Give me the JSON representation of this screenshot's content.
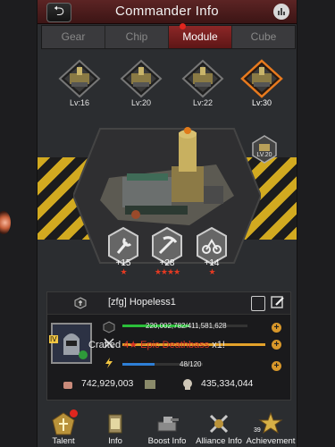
{
  "header": {
    "title": "Commander Info"
  },
  "tabs": [
    {
      "label": "Gear",
      "active": false
    },
    {
      "label": "Chip",
      "active": false
    },
    {
      "label": "Module",
      "active": true
    },
    {
      "label": "Cube",
      "active": false
    }
  ],
  "modules": [
    {
      "level": "Lv:16"
    },
    {
      "level": "Lv:20"
    },
    {
      "level": "Lv:22"
    },
    {
      "level": "Lv:30",
      "selected": true
    }
  ],
  "small_module": {
    "level": "LV.20"
  },
  "chips": [
    {
      "bonus": "+15",
      "stars": "★"
    },
    {
      "bonus": "+28",
      "stars": "★★★★"
    },
    {
      "bonus": "+14",
      "stars": "★"
    }
  ],
  "player": {
    "name": "[zfg]  Hopeless1",
    "avatar_badge": "IV"
  },
  "stats": {
    "xp": "220,002,782/411,581,628",
    "stamina": "48/120",
    "power": "742,929,003",
    "kills": "435,334,044"
  },
  "announcement": {
    "prefix": "Crafted ",
    "highlight": "4★ Epic Deathbass",
    "suffix": " x1!"
  },
  "nav": [
    {
      "label": "Talent",
      "alert": true
    },
    {
      "label": "Info"
    },
    {
      "label": "Boost Info"
    },
    {
      "label": "Alliance Info"
    },
    {
      "label": "Achievement",
      "count": "39"
    }
  ],
  "colors": {
    "accent_red": "#8c2727",
    "xp_bar": "#2bbf3a",
    "gold_bar": "#e3a22a",
    "stamina_bar": "#2e7fd6",
    "hazard_yellow": "#e1b51f"
  }
}
